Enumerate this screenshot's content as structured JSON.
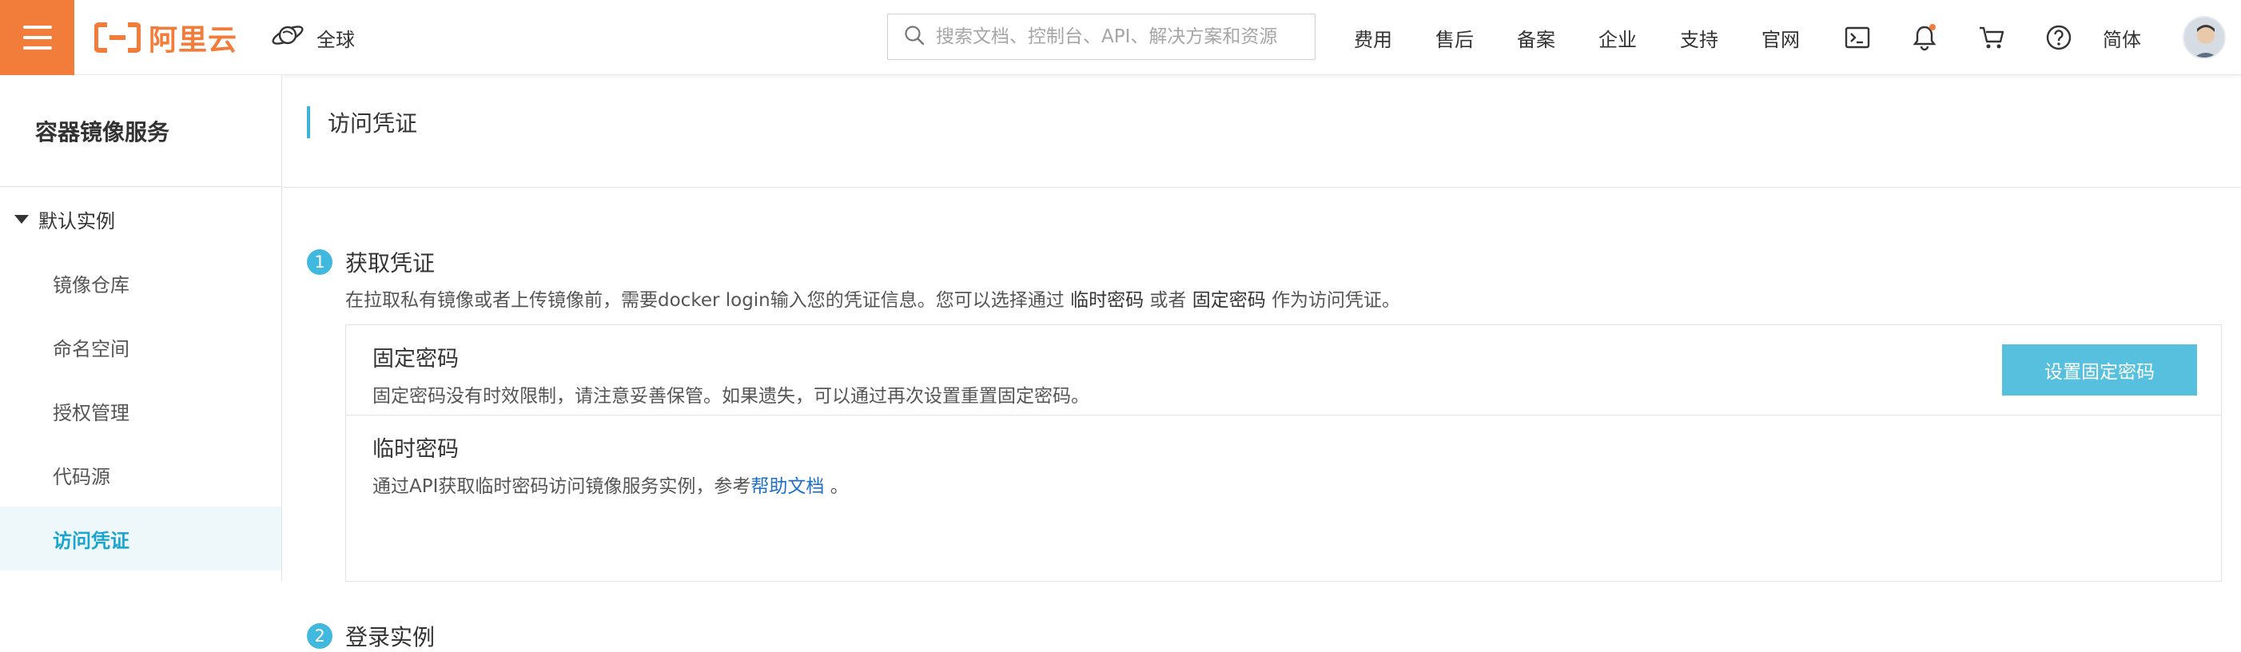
{
  "topbar": {
    "logo_text": "阿里云",
    "region": "全球",
    "search_placeholder": "搜索文档、控制台、API、解决方案和资源",
    "nav": [
      "费用",
      "售后",
      "备案",
      "企业",
      "支持",
      "官网"
    ],
    "language": "简体",
    "brand_color": "#f27c3a"
  },
  "sidebar": {
    "title": "容器镜像服务",
    "group": "默认实例",
    "items": [
      "镜像仓库",
      "命名空间",
      "授权管理",
      "代码源",
      "访问凭证"
    ],
    "active_index": 4
  },
  "main": {
    "page_title": "访问凭证",
    "step1": {
      "num": "1",
      "title": "获取凭证",
      "desc_prefix": "在拉取私有镜像或者上传镜像前，需要docker login输入您的凭证信息。您可以选择通过 ",
      "desc_em1": "临时密码",
      "desc_mid": " 或者 ",
      "desc_em2": "固定密码",
      "desc_suffix": " 作为访问凭证。"
    },
    "fixed": {
      "title": "固定密码",
      "desc": "固定密码没有时效限制，请注意妥善保管。如果遗失，可以通过再次设置重置固定密码。",
      "button": "设置固定密码"
    },
    "temp": {
      "title": "临时密码",
      "desc_prefix": "通过API获取临时密码访问镜像服务实例，参考",
      "link": "帮助文档",
      "desc_suffix": " 。"
    },
    "step2": {
      "num": "2",
      "title": "登录实例"
    }
  }
}
